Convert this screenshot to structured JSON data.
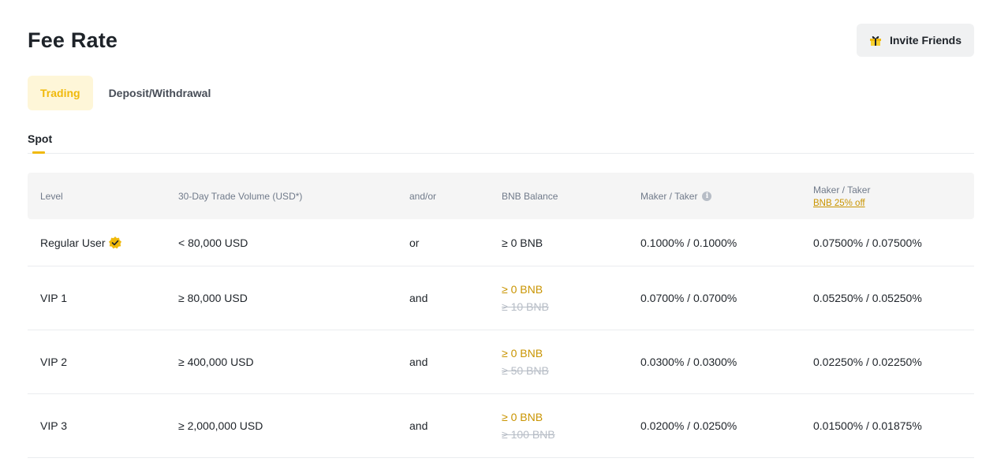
{
  "page": {
    "title": "Fee Rate"
  },
  "invite": {
    "label": "Invite Friends",
    "icon": "gift-icon"
  },
  "tabs": [
    {
      "label": "Trading",
      "active": true
    },
    {
      "label": "Deposit/Withdrawal",
      "active": false
    }
  ],
  "subtab": {
    "label": "Spot"
  },
  "table": {
    "headers": {
      "level": "Level",
      "volume": "30-Day Trade Volume (USD*)",
      "andor": "and/or",
      "bnb": "BNB Balance",
      "maker_taker": "Maker / Taker",
      "maker_taker_discount": "Maker / Taker",
      "discount_link": "BNB 25% off"
    },
    "rows": [
      {
        "level": "Regular User",
        "verified": true,
        "volume": "< 80,000 USD",
        "andor": "or",
        "bnb": "≥ 0 BNB",
        "bnb_old": "",
        "maker_taker": "0.1000% / 0.1000%",
        "maker_taker_discount": "0.07500% / 0.07500%"
      },
      {
        "level": "VIP 1",
        "volume": "≥ 80,000 USD",
        "andor": "and",
        "bnb": "≥ 0 BNB",
        "bnb_old": "≥ 10 BNB",
        "maker_taker": "0.0700% / 0.0700%",
        "maker_taker_discount": "0.05250% / 0.05250%"
      },
      {
        "level": "VIP 2",
        "volume": "≥ 400,000 USD",
        "andor": "and",
        "bnb": "≥ 0 BNB",
        "bnb_old": "≥ 50 BNB",
        "maker_taker": "0.0300% / 0.0300%",
        "maker_taker_discount": "0.02250% / 0.02250%"
      },
      {
        "level": "VIP 3",
        "volume": "≥ 2,000,000 USD",
        "andor": "and",
        "bnb": "≥ 0 BNB",
        "bnb_old": "≥ 100 BNB",
        "maker_taker": "0.0200% / 0.0250%",
        "maker_taker_discount": "0.01500% / 0.01875%"
      }
    ]
  },
  "colors": {
    "accent": "#f0b90b",
    "accent_dark": "#c99400",
    "muted": "#b7bdc6",
    "header_bg": "#f5f5f5"
  }
}
